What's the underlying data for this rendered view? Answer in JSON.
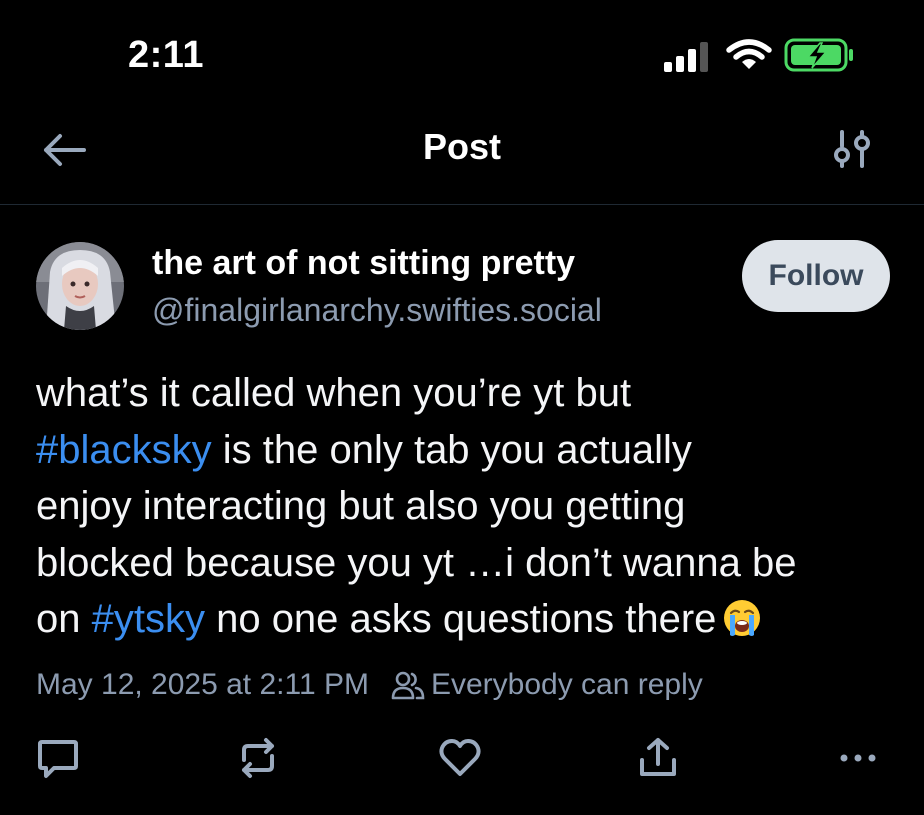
{
  "status_bar": {
    "time": "2:11",
    "battery_color": "#4cd964"
  },
  "header": {
    "title": "Post",
    "back_icon": "arrow-left-icon",
    "filter_icon": "sliders-icon"
  },
  "post": {
    "author": {
      "display_name": "the art of not sitting pretty",
      "handle": "@finalgirlanarchy.swifties.social"
    },
    "follow_label": "Follow",
    "text_lines": [
      [
        {
          "t": "what’s it called when you’re yt but"
        }
      ],
      [
        {
          "t": "#blacksky",
          "tag": true
        },
        {
          "t": " is the only tab you actually"
        }
      ],
      [
        {
          "t": "enjoy interacting but also you getting"
        }
      ],
      [
        {
          "t": "blocked because you yt …i don’t wanna be"
        }
      ],
      [
        {
          "t": "on "
        },
        {
          "t": "#ytsky",
          "tag": true
        },
        {
          "t": " no one asks questions there"
        }
      ]
    ],
    "emoji": "loudly-crying-face-emoji",
    "timestamp": "May 12, 2025 at 2:11 PM",
    "reply_setting": "Everybody can reply"
  },
  "actions": {
    "reply_icon": "comment-icon",
    "repost_icon": "repost-icon",
    "like_icon": "heart-icon",
    "share_icon": "share-icon",
    "more_icon": "more-icon"
  },
  "colors": {
    "background": "#000000",
    "hashtag": "#3b8ef0",
    "muted": "#8c9bb0",
    "follow_bg": "#dfe4ea"
  }
}
